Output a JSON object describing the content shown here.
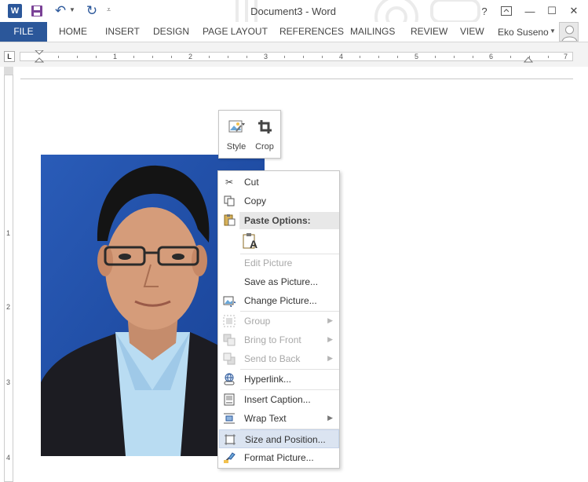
{
  "titlebar": {
    "title": "Document3 - Word",
    "word_logo": "W",
    "help": "?",
    "ribbon_options_icon": "ribbon-display-options",
    "minimize": "—",
    "maximize": "☐",
    "close": "✕"
  },
  "ribbon": {
    "tabs": [
      "FILE",
      "HOME",
      "INSERT",
      "DESIGN",
      "PAGE LAYOUT",
      "REFERENCES",
      "MAILINGS",
      "REVIEW",
      "VIEW"
    ],
    "user_name": "Eko Suseno"
  },
  "ruler": {
    "tab_selector": "L",
    "numbers": [
      "1",
      "2",
      "3",
      "4",
      "5",
      "6",
      "7"
    ],
    "vertical_numbers": [
      "1",
      "2",
      "3",
      "4"
    ]
  },
  "mini_toolbar": {
    "style_label": "Style",
    "crop_label": "Crop"
  },
  "context_menu": {
    "items": [
      {
        "label": "Cut",
        "icon": "scissors-icon",
        "enabled": true
      },
      {
        "label": "Copy",
        "icon": "copy-icon",
        "enabled": true
      },
      {
        "label": "Paste Options:",
        "icon": "paste-icon",
        "header": true
      },
      {
        "label": "Edit Picture",
        "enabled": false
      },
      {
        "label": "Save as Picture...",
        "enabled": true
      },
      {
        "label": "Change Picture...",
        "icon": "change-picture-icon",
        "enabled": true
      },
      {
        "label": "Group",
        "icon": "group-icon",
        "enabled": false,
        "submenu": true
      },
      {
        "label": "Bring to Front",
        "icon": "bring-front-icon",
        "enabled": false,
        "submenu": true
      },
      {
        "label": "Send to Back",
        "icon": "send-back-icon",
        "enabled": false,
        "submenu": true
      },
      {
        "label": "Hyperlink...",
        "icon": "hyperlink-icon",
        "enabled": true
      },
      {
        "label": "Insert Caption...",
        "icon": "caption-icon",
        "enabled": true
      },
      {
        "label": "Wrap Text",
        "icon": "wrap-text-icon",
        "enabled": true,
        "submenu": true
      },
      {
        "label": "Size and Position...",
        "icon": "size-position-icon",
        "enabled": true,
        "highlighted": true
      },
      {
        "label": "Format Picture...",
        "icon": "format-picture-icon",
        "enabled": true
      }
    ],
    "paste_option_glyph": "A"
  },
  "colors": {
    "accent": "#2b579a",
    "menu_highlight": "#dbe4f1",
    "photo_background": "#1f4fa8"
  }
}
